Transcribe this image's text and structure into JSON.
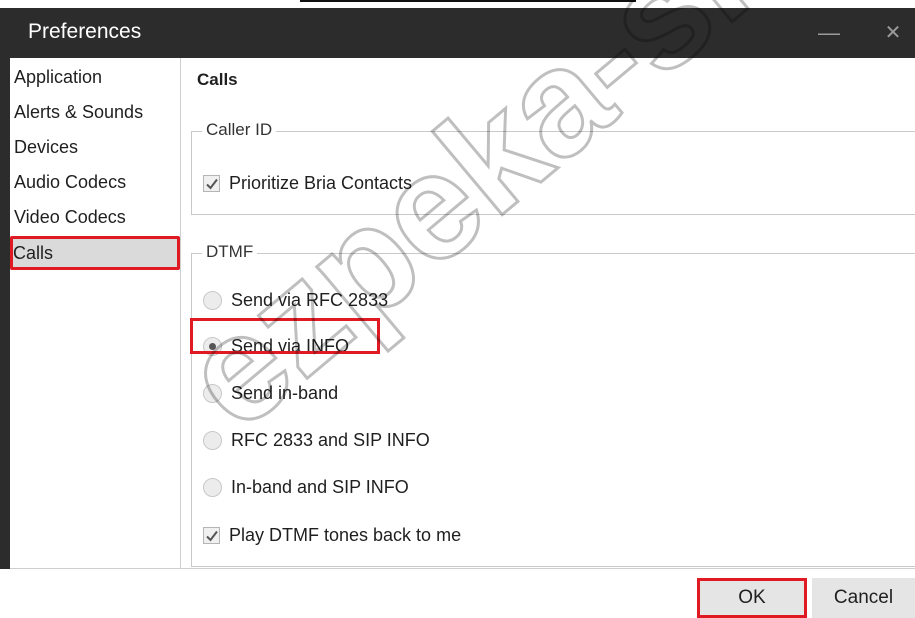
{
  "window": {
    "title": "Preferences",
    "minimize_glyph": "—",
    "close_glyph": "✕"
  },
  "sidebar": {
    "items": [
      {
        "label": "Application"
      },
      {
        "label": "Alerts & Sounds"
      },
      {
        "label": "Devices"
      },
      {
        "label": "Audio Codecs"
      },
      {
        "label": "Video Codecs"
      },
      {
        "label": "Calls",
        "selected": true
      }
    ]
  },
  "main": {
    "section_title": "Calls",
    "caller_id": {
      "label": "Caller ID",
      "prioritize_contacts": {
        "label": "Prioritize Bria Contacts",
        "checked": true
      }
    },
    "dtmf": {
      "label": "DTMF",
      "options": [
        {
          "label": "Send via RFC 2833",
          "checked": false
        },
        {
          "label": "Send via INFO",
          "checked": true
        },
        {
          "label": "Send in-band",
          "checked": false
        },
        {
          "label": "RFC 2833 and SIP INFO",
          "checked": false
        },
        {
          "label": "In-band and SIP INFO",
          "checked": false
        }
      ],
      "play_tones": {
        "label": "Play DTMF tones back to me",
        "checked": true
      }
    }
  },
  "footer": {
    "ok_label": "OK",
    "cancel_label": "Cancel"
  },
  "watermark": {
    "text": "ezpeka-shop"
  },
  "colors": {
    "titlebar": "#2c2c2c",
    "highlight": "#e01a22",
    "selected_bg": "#dadada"
  }
}
